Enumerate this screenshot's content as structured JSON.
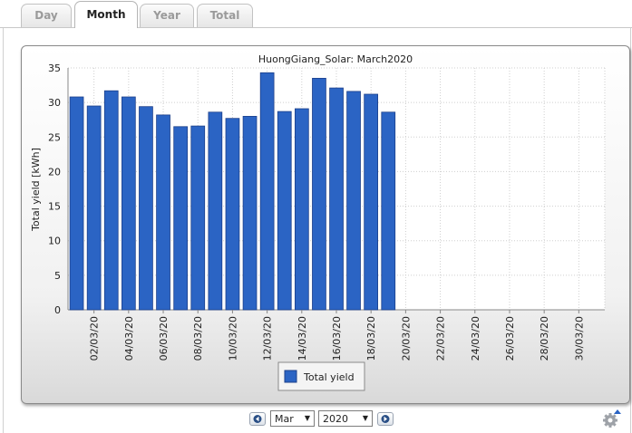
{
  "tabs": [
    {
      "label": "Day",
      "active": false
    },
    {
      "label": "Month",
      "active": true
    },
    {
      "label": "Year",
      "active": false
    },
    {
      "label": "Total",
      "active": false
    }
  ],
  "chart_data": {
    "type": "bar",
    "title": "HuongGiang_Solar: March2020",
    "ylabel": "Total yield [kWh]",
    "xlabel": "",
    "ylim": [
      0,
      35
    ],
    "yticks": [
      0,
      5,
      10,
      15,
      20,
      25,
      30,
      35
    ],
    "grid": true,
    "legend_position": "bottom-center",
    "categories": [
      "01/03/20",
      "02/03/20",
      "03/03/20",
      "04/03/20",
      "05/03/20",
      "06/03/20",
      "07/03/20",
      "08/03/20",
      "09/03/20",
      "10/03/20",
      "11/03/20",
      "12/03/20",
      "13/03/20",
      "14/03/20",
      "15/03/20",
      "16/03/20",
      "17/03/20",
      "18/03/20",
      "19/03/20",
      "20/03/20",
      "21/03/20",
      "22/03/20",
      "23/03/20",
      "24/03/20",
      "25/03/20",
      "26/03/20",
      "27/03/20",
      "28/03/20",
      "29/03/20",
      "30/03/20",
      "31/03/20"
    ],
    "tick_labels": [
      "02/03/20",
      "04/03/20",
      "06/03/20",
      "08/03/20",
      "10/03/20",
      "12/03/20",
      "14/03/20",
      "16/03/20",
      "18/03/20",
      "20/03/20",
      "22/03/20",
      "24/03/20",
      "26/03/20",
      "28/03/20",
      "30/03/20"
    ],
    "series": [
      {
        "name": "Total yield",
        "color": "#2b64c4",
        "values": [
          30.8,
          29.5,
          31.7,
          30.8,
          29.4,
          28.2,
          26.5,
          26.6,
          28.6,
          27.7,
          28.0,
          34.3,
          28.7,
          29.1,
          33.5,
          32.1,
          31.6,
          31.2,
          28.6,
          null,
          null,
          null,
          null,
          null,
          null,
          null,
          null,
          null,
          null,
          null,
          null
        ]
      }
    ]
  },
  "controls": {
    "prev_icon": "arrow-left-icon",
    "next_icon": "arrow-right-icon",
    "month_value": "Mar",
    "year_value": "2020",
    "settings_icon": "gear-icon"
  },
  "colors": {
    "bar": "#2b64c4",
    "bar_border": "#1c3f8a",
    "grid": "#cfcfcf"
  }
}
